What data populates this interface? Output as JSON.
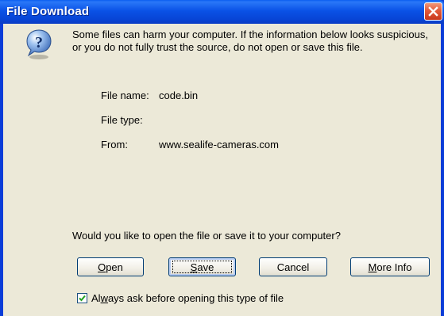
{
  "window": {
    "title": "File Download"
  },
  "message": "Some files can harm your computer. If the information below looks suspicious, or you do not fully trust the source, do not open or save this file.",
  "file_info": {
    "name_label": "File name:",
    "name_value": "code.bin",
    "type_label": "File type:",
    "type_value": "",
    "from_label": "From:",
    "from_value": "www.sealife-cameras.com"
  },
  "prompt": "Would you like to open the file or save it to your computer?",
  "buttons": {
    "open": {
      "mnemonic": "O",
      "rest": "pen"
    },
    "save": {
      "mnemonic": "S",
      "rest": "ave"
    },
    "cancel": "Cancel",
    "more_info": {
      "mnemonic": "M",
      "rest": "ore Info"
    }
  },
  "checkbox": {
    "checked": true,
    "pre": "Al",
    "mnemonic": "w",
    "post": "ays ask before opening this type of file"
  },
  "icons": {
    "question": "question-icon",
    "close": "close-icon",
    "check": "checkmark-icon"
  },
  "colors": {
    "titlebar": "#0a52e6",
    "dialog_bg": "#ece9d8",
    "close": "#e25a3a"
  }
}
